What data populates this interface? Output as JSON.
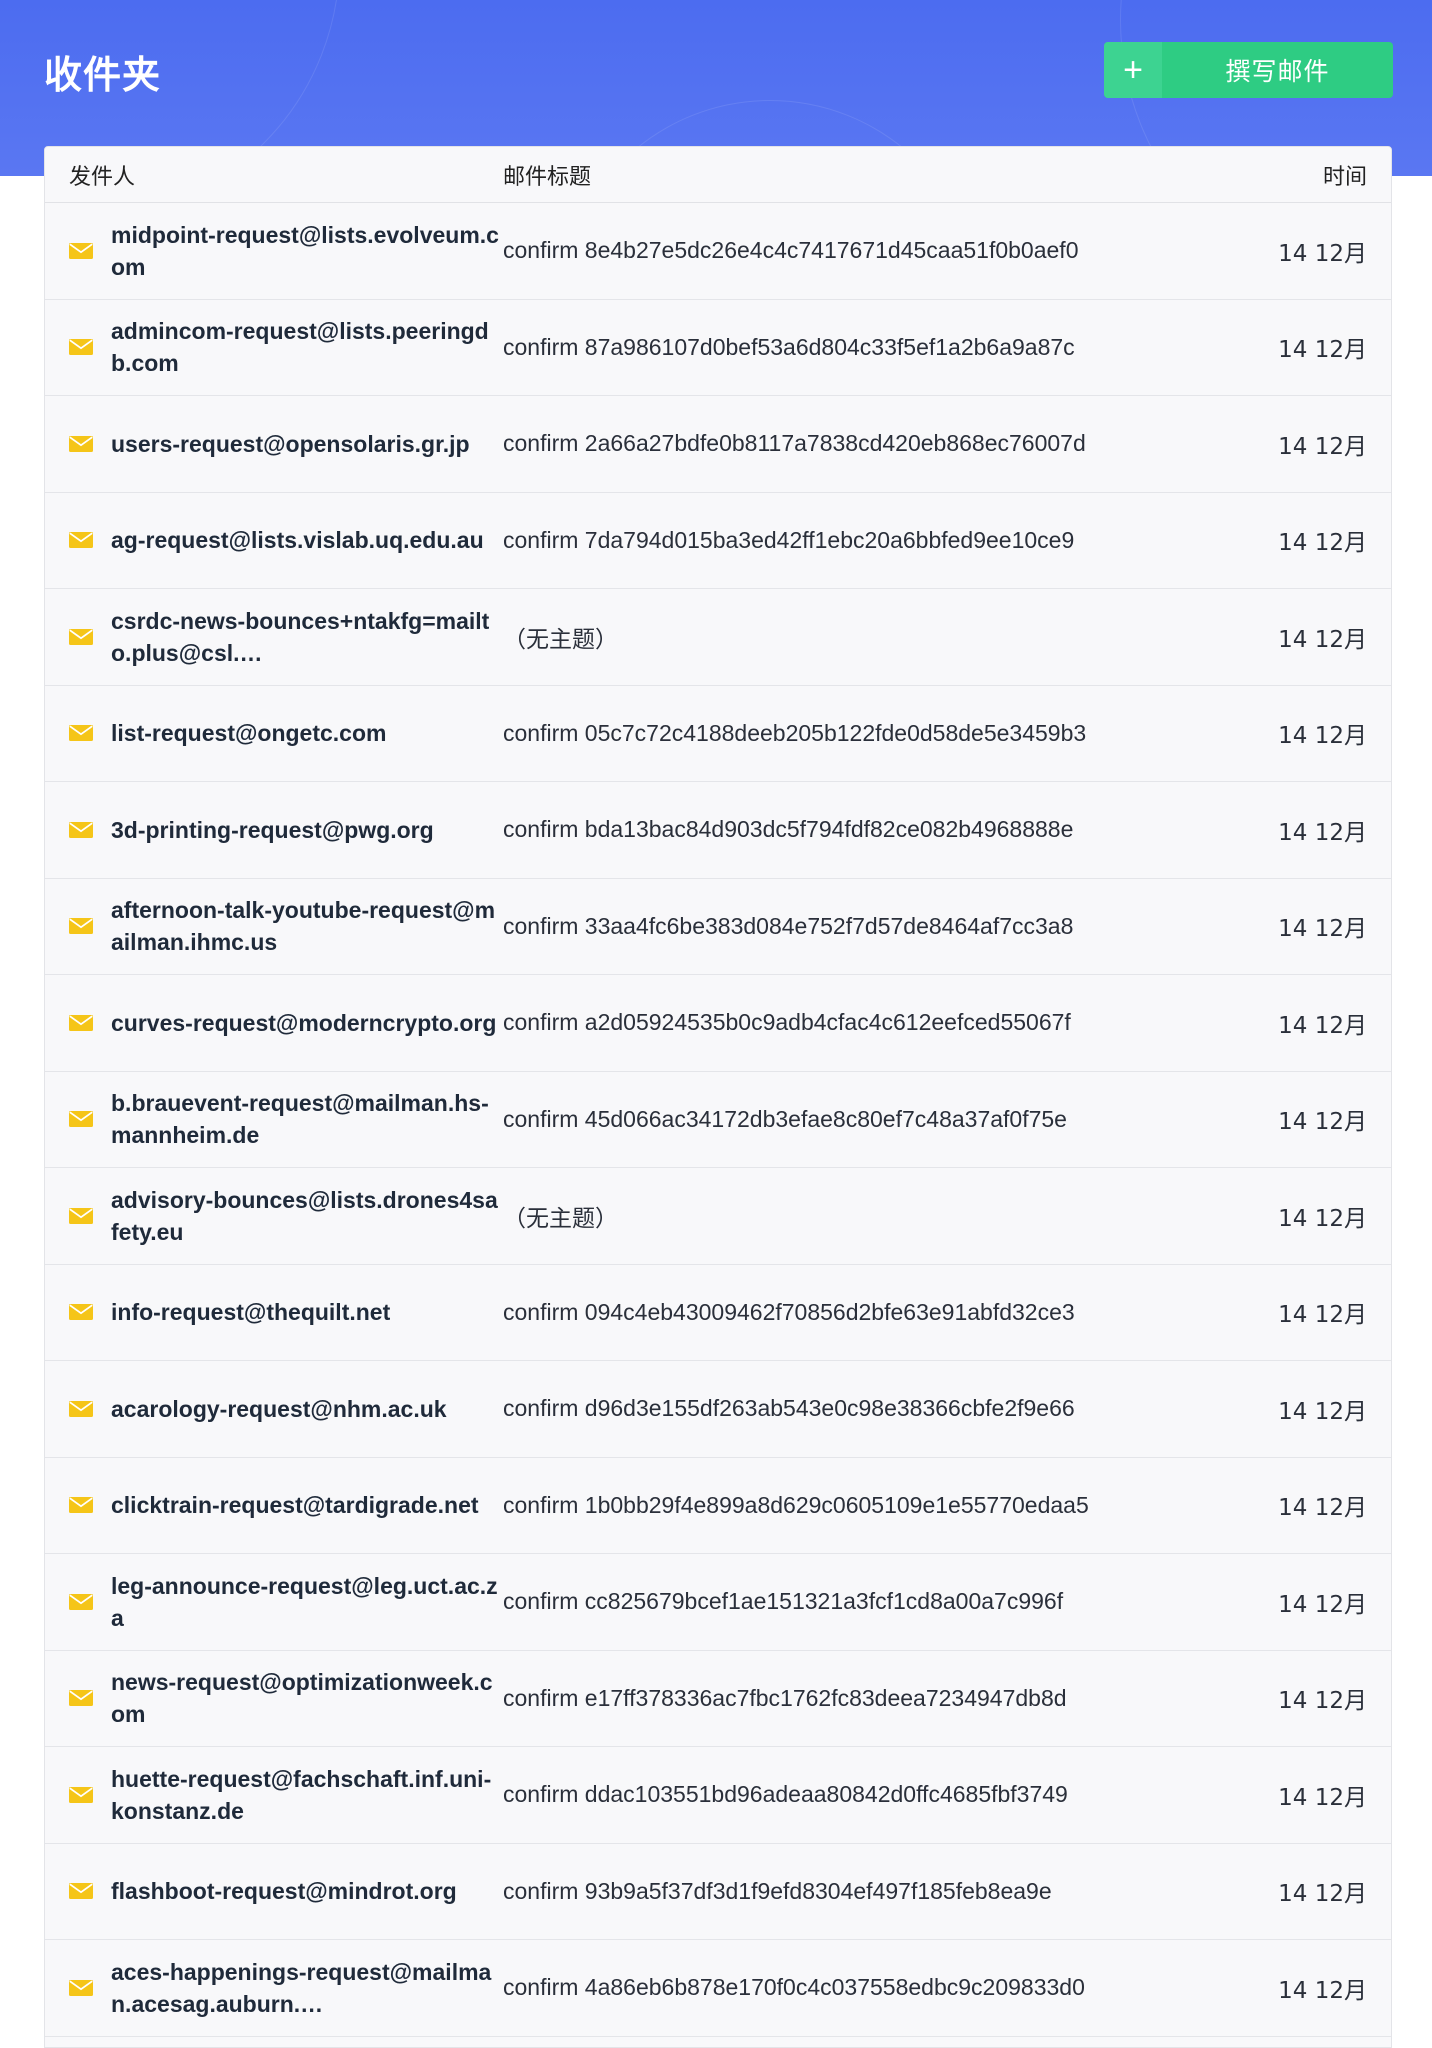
{
  "header": {
    "title": "收件夹",
    "compose_plus": "+",
    "compose_label": "撰写邮件"
  },
  "columns": {
    "sender": "发件人",
    "subject": "邮件标题",
    "time": "时间"
  },
  "colors": {
    "header_bg": "#4c6cf0",
    "compose_bg": "#2ecc83",
    "envelope": "#f5c518"
  },
  "emails": [
    {
      "sender": "midpoint-request@lists.evolveum.com",
      "subject": "confirm 8e4b27e5dc26e4c4c7417671d45caa51f0b0aef0",
      "time": "14 12月"
    },
    {
      "sender": "admincom-request@lists.peeringdb.com",
      "subject": "confirm 87a986107d0bef53a6d804c33f5ef1a2b6a9a87c",
      "time": "14 12月"
    },
    {
      "sender": "users-request@opensolaris.gr.jp",
      "subject": "confirm 2a66a27bdfe0b8117a7838cd420eb868ec76007d",
      "time": "14 12月"
    },
    {
      "sender": "ag-request@lists.vislab.uq.edu.au",
      "subject": "confirm 7da794d015ba3ed42ff1ebc20a6bbfed9ee10ce9",
      "time": "14 12月"
    },
    {
      "sender": "csrdc-news-bounces+ntakfg=mailto.plus@csl.…",
      "subject": "（无主题）",
      "time": "14 12月"
    },
    {
      "sender": "list-request@ongetc.com",
      "subject": "confirm 05c7c72c4188deeb205b122fde0d58de5e3459b3",
      "time": "14 12月"
    },
    {
      "sender": "3d-printing-request@pwg.org",
      "subject": "confirm bda13bac84d903dc5f794fdf82ce082b4968888e",
      "time": "14 12月"
    },
    {
      "sender": "afternoon-talk-youtube-request@mailman.ihmc.us",
      "subject": "confirm 33aa4fc6be383d084e752f7d57de8464af7cc3a8",
      "time": "14 12月"
    },
    {
      "sender": "curves-request@moderncrypto.org",
      "subject": "confirm a2d05924535b0c9adb4cfac4c612eefced55067f",
      "time": "14 12月"
    },
    {
      "sender": "b.brauevent-request@mailman.hs-mannheim.de",
      "subject": "confirm 45d066ac34172db3efae8c80ef7c48a37af0f75e",
      "time": "14 12月"
    },
    {
      "sender": "advisory-bounces@lists.drones4safety.eu",
      "subject": "（无主题）",
      "time": "14 12月"
    },
    {
      "sender": "info-request@thequilt.net",
      "subject": "confirm 094c4eb43009462f70856d2bfe63e91abfd32ce3",
      "time": "14 12月"
    },
    {
      "sender": "acarology-request@nhm.ac.uk",
      "subject": "confirm d96d3e155df263ab543e0c98e38366cbfe2f9e66",
      "time": "14 12月"
    },
    {
      "sender": "clicktrain-request@tardigrade.net",
      "subject": "confirm 1b0bb29f4e899a8d629c0605109e1e55770edaa5",
      "time": "14 12月"
    },
    {
      "sender": "leg-announce-request@leg.uct.ac.za",
      "subject": "confirm cc825679bcef1ae151321a3fcf1cd8a00a7c996f",
      "time": "14 12月"
    },
    {
      "sender": "news-request@optimizationweek.com",
      "subject": "confirm e17ff378336ac7fbc1762fc83deea7234947db8d",
      "time": "14 12月"
    },
    {
      "sender": "huette-request@fachschaft.inf.uni-konstanz.de",
      "subject": "confirm ddac103551bd96adeaa80842d0ffc4685fbf3749",
      "time": "14 12月"
    },
    {
      "sender": "flashboot-request@mindrot.org",
      "subject": "confirm 93b9a5f37df3d1f9efd8304ef497f185feb8ea9e",
      "time": "14 12月"
    },
    {
      "sender": "aces-happenings-request@mailman.acesag.auburn.…",
      "subject": "confirm 4a86eb6b878e170f0c4c037558edbc9c209833d0",
      "time": "14 12月"
    }
  ]
}
